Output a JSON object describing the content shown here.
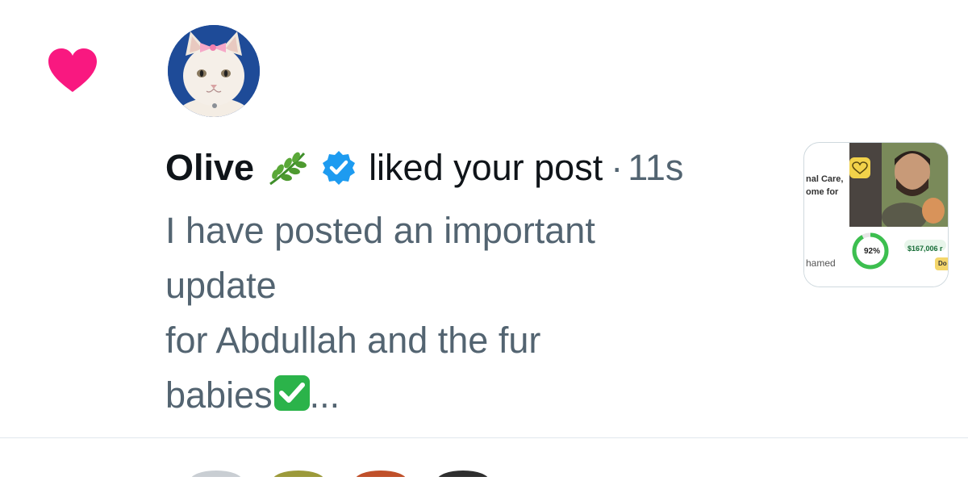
{
  "notification": {
    "icon": "heart-icon",
    "icon_color": "#f91880",
    "user": {
      "name": "Olive",
      "emoji": "herb-icon",
      "verified": true,
      "verified_color": "#1d9bf0"
    },
    "action": "liked your post",
    "separator": "·",
    "time": "11s",
    "preview_lines": [
      "I have posted an important",
      "update",
      "for Abdullah and the fur",
      "babies"
    ],
    "preview_suffix": "...",
    "preview_emoji": "check-mark-button-icon",
    "thumbnail": {
      "text_line_1": "nal Care,",
      "text_line_2": "ome for",
      "name_text": "hamed",
      "progress_label": "92%",
      "progress": 0.92,
      "amount": "$167,006 r",
      "button_text": "Do"
    }
  },
  "colors": {
    "text_primary": "#0f1419",
    "text_secondary": "#536471",
    "divider": "#e1e8ed"
  }
}
